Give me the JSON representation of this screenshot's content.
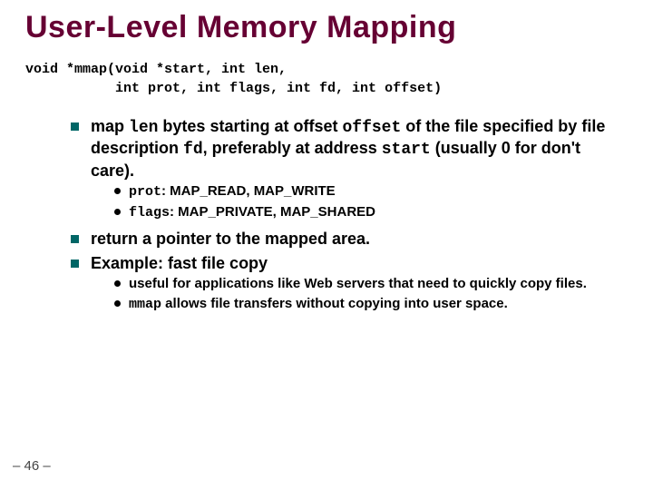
{
  "title": "User-Level Memory Mapping",
  "signature": {
    "line1": "void *mmap(void *start, int len,",
    "line2": "           int prot, int flags, int fd, int offset)"
  },
  "bullets": {
    "b1_pre": "map ",
    "b1_len": "len",
    "b1_mid1": " bytes starting at offset ",
    "b1_offset": "offset",
    "b1_mid2": " of the file specified by file description ",
    "b1_fd": "fd",
    "b1_mid3": ", preferably at address ",
    "b1_start": "start",
    "b1_post": " (usually 0 for don't care).",
    "b1_sub1_code": "prot",
    "b1_sub1_text": ": MAP_READ, MAP_WRITE",
    "b1_sub2_code": "flags",
    "b1_sub2_text": ": MAP_PRIVATE, MAP_SHARED",
    "b2": "return a pointer to the mapped area.",
    "b3": "Example: fast file copy",
    "b3_sub1": "useful for applications like Web servers that need to quickly copy files.",
    "b3_sub2_code": "mmap",
    "b3_sub2_text": " allows file transfers without copying into user space."
  },
  "page": "– 46 –"
}
